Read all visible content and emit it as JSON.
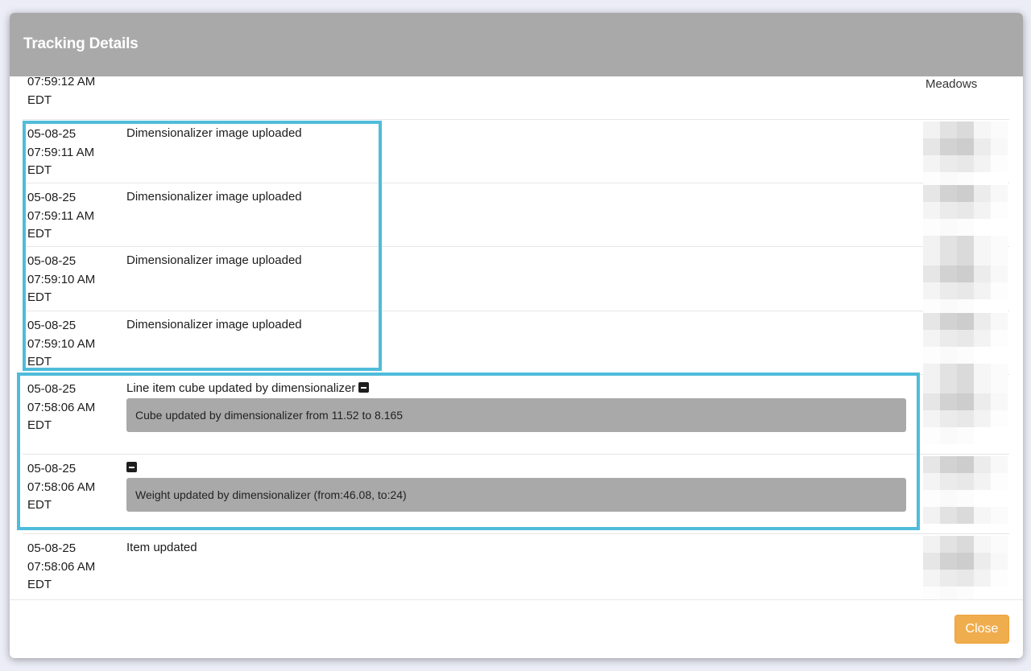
{
  "modal": {
    "title": "Tracking Details",
    "close_label": "Close"
  },
  "top_partial_row": {
    "time_line": "07:59:12 AM",
    "tz": "EDT",
    "user": "Meadows"
  },
  "rows": [
    {
      "date": "05-08-25",
      "time": "07:59:11 AM",
      "tz": "EDT",
      "description": "Dimensionalizer image uploaded"
    },
    {
      "date": "05-08-25",
      "time": "07:59:11 AM",
      "tz": "EDT",
      "description": "Dimensionalizer image uploaded"
    },
    {
      "date": "05-08-25",
      "time": "07:59:10 AM",
      "tz": "EDT",
      "description": "Dimensionalizer image uploaded"
    },
    {
      "date": "05-08-25",
      "time": "07:59:10 AM",
      "tz": "EDT",
      "description": "Dimensionalizer image uploaded"
    },
    {
      "date": "05-08-25",
      "time": "07:58:06 AM",
      "tz": "EDT",
      "description": "Line item cube updated by dimensionalizer",
      "detail": "Cube updated by dimensionalizer from 11.52 to 8.165"
    },
    {
      "date": "05-08-25",
      "time": "07:58:06 AM",
      "tz": "EDT",
      "description": "",
      "detail": "Weight updated by dimensionalizer (from:46.08, to:24)"
    },
    {
      "date": "05-08-25",
      "time": "07:58:06 AM",
      "tz": "EDT",
      "description": "Item updated"
    }
  ],
  "colors": {
    "header_bg": "#a9a9a9",
    "highlight": "#4fbcda",
    "close_button": "#f0ad4e",
    "detail_box": "#a9a9a9"
  },
  "icons": {
    "collapse": "minus-square-icon"
  }
}
